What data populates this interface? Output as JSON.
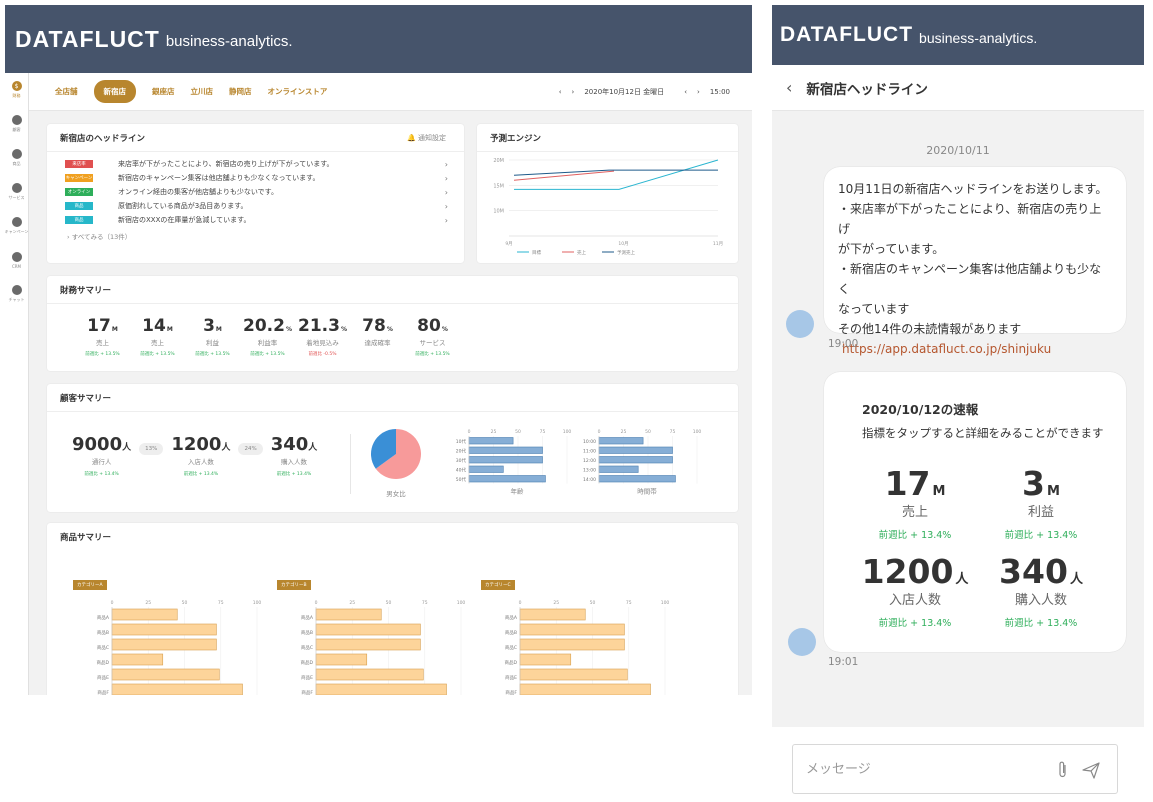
{
  "brand": {
    "logo": "DATAFLUCT",
    "sub": "business-analytics."
  },
  "sidenav": [
    {
      "label": "財務",
      "icon": "dollar-icon",
      "glyph": "$"
    },
    {
      "label": "顧客",
      "icon": "person-icon",
      "glyph": ""
    },
    {
      "label": "商品",
      "icon": "basket-icon",
      "glyph": ""
    },
    {
      "label": "サービス",
      "icon": "person-icon",
      "glyph": ""
    },
    {
      "label": "キャンペーン",
      "icon": "play-icon",
      "glyph": ""
    },
    {
      "label": "CRM",
      "icon": "contact-icon",
      "glyph": ""
    },
    {
      "label": "チャット",
      "icon": "chat-icon",
      "glyph": ""
    }
  ],
  "tabs": [
    "全店舗",
    "新宿店",
    "銀座店",
    "立川店",
    "静岡店",
    "オンラインストア"
  ],
  "date": {
    "prev": "‹",
    "next": "›",
    "date": "2020年10月12日 金曜日",
    "time": "15:00"
  },
  "headline": {
    "title": "新宿店のヘッドライン",
    "notify": "通知設定",
    "items": [
      {
        "badge": "来店率",
        "color": "#e05050",
        "text": "来店率が下がったことにより、新宿店の売り上げが下がっています。"
      },
      {
        "badge": "キャンペーン",
        "color": "#f0a020",
        "text": "新宿店のキャンペーン集客は他店舗よりも少なくなっています。"
      },
      {
        "badge": "オンライン",
        "color": "#2eae5a",
        "text": "オンライン経由の集客が他店舗よりも少ないです。"
      },
      {
        "badge": "商品",
        "color": "#26b7c9",
        "text": "原価割れしている商品が3品目あります。"
      },
      {
        "badge": "商品",
        "color": "#26b7c9",
        "text": "新宿店のXXXの在庫量が急減しています。"
      }
    ],
    "see_all": "すべてみる（13件）"
  },
  "forecast": {
    "title": "予測エンジン",
    "chart_data": {
      "type": "line",
      "x": [
        "9月",
        "10月",
        "11月"
      ],
      "yticks": [
        "20M",
        "15M",
        "10M"
      ],
      "series": [
        {
          "name": "目標",
          "color": "#2ab5d0",
          "values": [
            14.2,
            14.2,
            14.2,
            20
          ]
        },
        {
          "name": "売上",
          "color": "#e06060",
          "values": [
            16,
            17.8
          ]
        },
        {
          "name": "予測売上",
          "color": "#1e5a8a",
          "values": [
            17,
            18,
            18,
            18
          ]
        }
      ]
    }
  },
  "finance": {
    "title": "財務サマリー",
    "items": [
      {
        "value": "17",
        "unit": "M",
        "label": "売上",
        "change": "前週比 + 13.5%",
        "neg": false
      },
      {
        "value": "14",
        "unit": "M",
        "label": "売上",
        "change": "前週比 + 13.5%",
        "neg": false
      },
      {
        "value": "3",
        "unit": "M",
        "label": "利益",
        "change": "前週比 + 13.5%",
        "neg": false
      },
      {
        "value": "20.2",
        "unit": "%",
        "label": "利益率",
        "change": "前週比 + 13.5%",
        "neg": false
      },
      {
        "value": "21.3",
        "unit": "%",
        "label": "着地見込み",
        "change": "前週比 -0.5%",
        "neg": true
      },
      {
        "value": "78",
        "unit": "%",
        "label": "達成確率",
        "change": "",
        "neg": false
      },
      {
        "value": "80",
        "unit": "%",
        "label": "サービス",
        "change": "前週比 + 13.5%",
        "neg": false
      }
    ]
  },
  "customer": {
    "title": "顧客サマリー",
    "visitors": {
      "value": "9000",
      "unit": "人",
      "label": "通行人",
      "change": "前週比 + 13.4%"
    },
    "pct1": "13%",
    "entrants": {
      "value": "1200",
      "unit": "人",
      "label": "入店人数",
      "change": "前週比 + 13.4%"
    },
    "pct2": "24%",
    "buyers": {
      "value": "340",
      "unit": "人",
      "label": "購入人数",
      "change": "前週比 + 13.4%"
    },
    "gender": {
      "label": "男女比",
      "chart_data": {
        "type": "pie",
        "values": [
          65,
          35
        ],
        "colors": [
          "#f79a9a",
          "#3a8fd6"
        ]
      }
    },
    "age": {
      "label": "年齢",
      "chart_data": {
        "type": "bar",
        "categories": [
          "10代",
          "20代",
          "30代",
          "40代",
          "50代"
        ],
        "values": [
          45,
          75,
          75,
          35,
          78
        ],
        "xticks": [
          "0",
          "25",
          "50",
          "75",
          "100"
        ]
      }
    },
    "hour": {
      "label": "時間帯",
      "chart_data": {
        "type": "bar",
        "categories": [
          "10:00",
          "11:00",
          "12:00",
          "13:00",
          "14:00"
        ],
        "values": [
          45,
          75,
          75,
          40,
          78
        ],
        "xticks": [
          "0",
          "25",
          "50",
          "75",
          "100"
        ]
      }
    }
  },
  "product": {
    "title": "商品サマリー",
    "categories": [
      {
        "tag": "カテゴリーA",
        "chart_data": {
          "type": "bar",
          "categories": [
            "商品A",
            "商品B",
            "商品C",
            "商品D",
            "商品E",
            "商品F"
          ],
          "values": [
            45,
            72,
            72,
            35,
            74,
            90
          ],
          "xticks": [
            "0",
            "25",
            "50",
            "75",
            "100"
          ]
        }
      },
      {
        "tag": "カテゴリーB",
        "chart_data": {
          "type": "bar",
          "categories": [
            "商品A",
            "商品B",
            "商品C",
            "商品D",
            "商品E",
            "商品F"
          ],
          "values": [
            45,
            72,
            72,
            35,
            74,
            90
          ],
          "xticks": [
            "0",
            "25",
            "50",
            "75",
            "100"
          ]
        }
      },
      {
        "tag": "カテゴリーC",
        "chart_data": {
          "type": "bar",
          "categories": [
            "商品A",
            "商品B",
            "商品C",
            "商品D",
            "商品E",
            "商品F"
          ],
          "values": [
            45,
            72,
            72,
            35,
            74,
            90
          ],
          "xticks": [
            "0",
            "25",
            "50",
            "75",
            "100"
          ]
        }
      }
    ]
  },
  "chat": {
    "title": "新宿店ヘッドライン",
    "date": "2020/10/11",
    "message1": [
      "10月11日の新宿店ヘッドラインをお送りします。",
      "・来店率が下がったことにより、新宿店の売り上げ",
      "が下がっています。",
      "・新宿店のキャンペーン集客は他店舗よりも少なく",
      "なっています",
      "その他14件の未読情報があります"
    ],
    "link": "https://app.datafluct.co.jp/shinjuku",
    "time1": "19:00",
    "report": {
      "title": "2020/10/12の速報",
      "sub": "指標をタップすると詳細をみることができます",
      "stats": [
        {
          "value": "17",
          "unit": "M",
          "label": "売上",
          "change": "前週比 + 13.4%"
        },
        {
          "value": "3",
          "unit": "M",
          "label": "利益",
          "change": "前週比 + 13.4%"
        },
        {
          "value": "1200",
          "unit": "人",
          "label": "入店人数",
          "change": "前週比 + 13.4%"
        },
        {
          "value": "340",
          "unit": "人",
          "label": "購入人数",
          "change": "前週比 + 13.4%"
        }
      ]
    },
    "time2": "19:01",
    "input_placeholder": "メッセージ"
  }
}
